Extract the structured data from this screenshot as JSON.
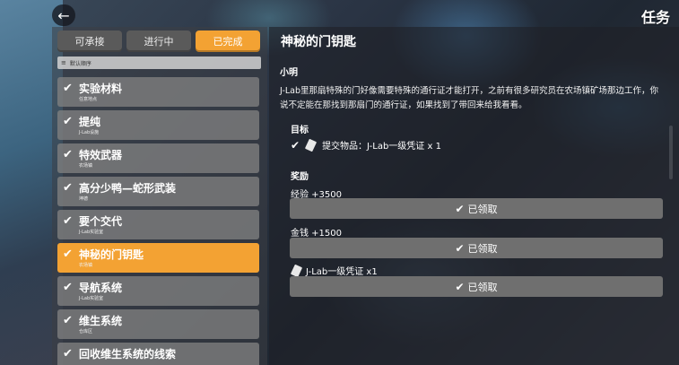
{
  "header": {
    "back_icon": "arrow-left-icon",
    "title": "任务"
  },
  "tabs": [
    {
      "label": "可承接",
      "active": false
    },
    {
      "label": "进行中",
      "active": false
    },
    {
      "label": "已完成",
      "active": true
    }
  ],
  "sort": {
    "label": "默认顺序",
    "icon": "sort-icon"
  },
  "quests": [
    {
      "name": "实验材料",
      "location": "任意地点",
      "completed": true,
      "selected": false
    },
    {
      "name": "提纯",
      "location": "J-Lab设施",
      "completed": true,
      "selected": false
    },
    {
      "name": "特效武器",
      "location": "农场镇",
      "completed": true,
      "selected": false
    },
    {
      "name": "高分少鸭—蛇形武装",
      "location": "坤德",
      "completed": true,
      "selected": false
    },
    {
      "name": "要个交代",
      "location": "J-Lab实验室",
      "completed": true,
      "selected": false
    },
    {
      "name": "神秘的门钥匙",
      "location": "农场镇",
      "completed": true,
      "selected": true
    },
    {
      "name": "导航系统",
      "location": "J-Lab实验室",
      "completed": true,
      "selected": false
    },
    {
      "name": "维生系统",
      "location": "仓库区",
      "completed": true,
      "selected": false
    },
    {
      "name": "回收维生系统的线索",
      "location": "",
      "completed": true,
      "selected": false
    }
  ],
  "detail": {
    "title": "神秘的门钥匙",
    "giver": "小明",
    "description": "J-Lab里那扇特殊的门好像需要特殊的通行证才能打开，之前有很多研究员在农场镇矿场那边工作，你说不定能在那找到那扇门的通行证，如果找到了带回来给我看看。",
    "goal_heading": "目标",
    "goals": [
      {
        "text": "提交物品：J-Lab一级凭证 x 1",
        "completed": true,
        "icon": "card-icon"
      }
    ],
    "reward_heading": "奖励",
    "rewards": [
      {
        "label": "经验 +3500",
        "button": "已领取"
      },
      {
        "label": "金钱 +1500",
        "button": "已领取"
      },
      {
        "label": "J-Lab一级凭证 x1",
        "icon": "card-icon",
        "button": "已领取"
      }
    ]
  },
  "colors": {
    "accent": "#f3a233",
    "tab_inactive": "#5a5a5a",
    "list_item": "#808080",
    "claim_button": "#6f6f6f"
  }
}
